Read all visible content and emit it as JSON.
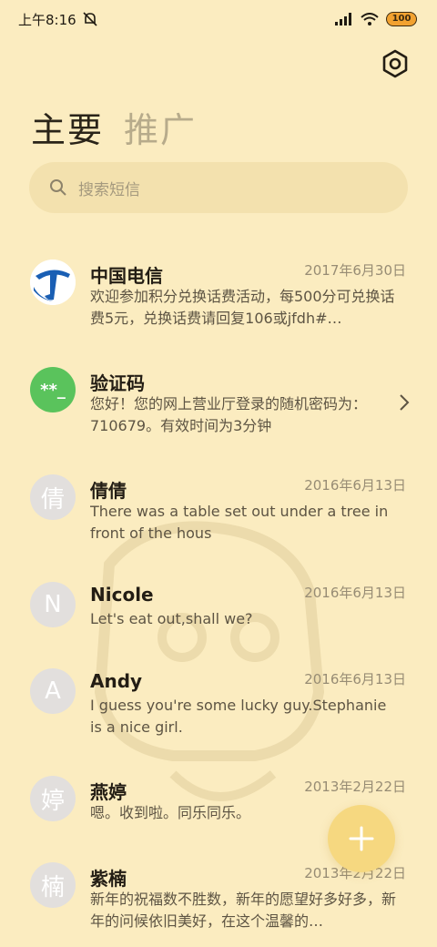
{
  "status_bar": {
    "time": "上午8:16",
    "battery": "100"
  },
  "tabs": [
    {
      "label": "主要"
    },
    {
      "label": "推广"
    }
  ],
  "search": {
    "placeholder": "搜索短信"
  },
  "conversations": [
    {
      "name": "中国电信",
      "date": "2017年6月30日",
      "snippet": "欢迎参加积分兑换话费活动，每500分可兑换话费5元，兑换话费请回复106或jfdh#…",
      "avatar": "telecom-logo"
    },
    {
      "name": "验证码",
      "date": "",
      "snippet": "您好！您的网上营业厅登录的随机密码为：710679。有效时间为3分钟",
      "avatar_text": "**_"
    },
    {
      "name": "倩倩",
      "date": "2016年6月13日",
      "snippet": "There was a table set out under a tree in front of the hous",
      "avatar_text": "倩"
    },
    {
      "name": "Nicole",
      "date": "2016年6月13日",
      "snippet": "Let's eat out,shall we?",
      "avatar_text": "N"
    },
    {
      "name": "Andy",
      "date": "2016年6月13日",
      "snippet": "I guess you're some lucky guy.Stephanie is a nice girl.",
      "avatar_text": "A"
    },
    {
      "name": "燕婷",
      "date": "2013年2月22日",
      "snippet": "嗯。收到啦。同乐同乐。",
      "avatar_text": "婷"
    },
    {
      "name": "紫楠",
      "date": "2013年2月22日",
      "snippet": "新年的祝福数不胜数，新年的愿望好多好多，新年的问候依旧美好，在这个温馨的…",
      "avatar_text": "楠"
    }
  ],
  "colors": {
    "background": "#fbecc0",
    "search_bg": "#f3e1ae",
    "fab": "#f6d880",
    "green_avatar": "#5ac35c",
    "telecom_blue": "#1a5fb4"
  }
}
